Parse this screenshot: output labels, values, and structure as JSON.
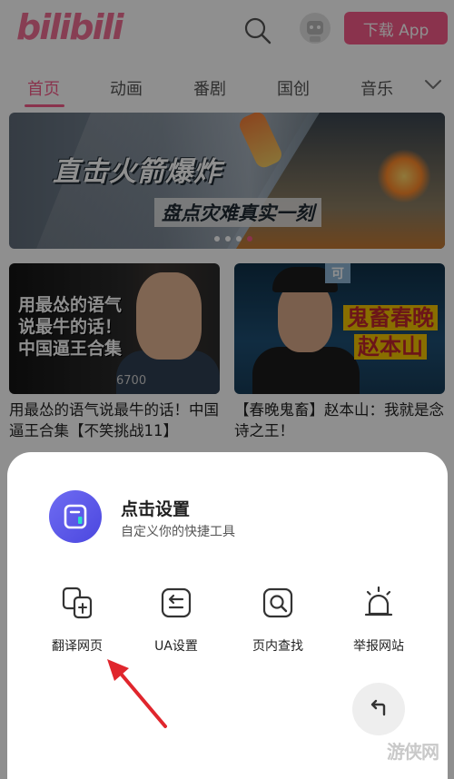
{
  "header": {
    "logo": "bilibili",
    "download_label": "下载 App"
  },
  "tabs": [
    {
      "label": "首页"
    },
    {
      "label": "动画"
    },
    {
      "label": "番剧"
    },
    {
      "label": "国创"
    },
    {
      "label": "音乐"
    }
  ],
  "banner": {
    "title": "直击火箭爆炸",
    "subtitle": "盘点灾难真实一刻"
  },
  "videos": [
    {
      "thumb_text": "用最怂的语气说最牛的话！中国逼王合集",
      "view_count": "6700",
      "title": "用最怂的语气说最牛的话！中国逼王合集【不笑挑战11】"
    },
    {
      "thumb_badge": "可",
      "thumb_line1": "鬼畜春晚",
      "thumb_line2": "赵本山",
      "title": "【春晚鬼畜】赵本山：我就是念诗之王！"
    }
  ],
  "sheet": {
    "title": "点击设置",
    "subtitle": "自定义你的快捷工具",
    "tools": [
      {
        "label": "翻译网页",
        "icon": "translate-icon"
      },
      {
        "label": "UA设置",
        "icon": "ua-settings-icon"
      },
      {
        "label": "页内查找",
        "icon": "find-in-page-icon"
      },
      {
        "label": "举报网站",
        "icon": "alarm-report-icon"
      }
    ]
  },
  "watermark": "游侠网",
  "colors": {
    "accent": "#f65b8a",
    "app_icon": "#5a57e8",
    "arrow": "#e0262d"
  }
}
